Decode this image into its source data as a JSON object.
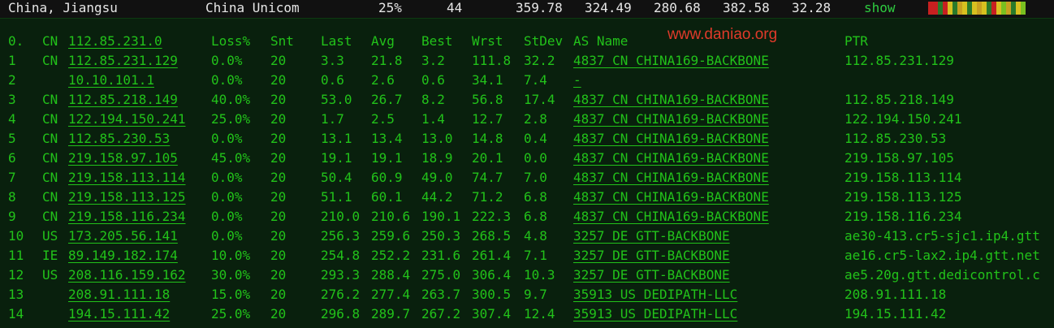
{
  "top": {
    "location": "China, Jiangsu",
    "isp": "China Unicom",
    "loss": "25%",
    "sent": "44",
    "last": "359.78",
    "avg": "324.49",
    "best": "280.68",
    "wrst": "382.58",
    "stdev": "32.28",
    "show": "show",
    "spark_colors": [
      "#c82020",
      "#c82020",
      "#2a7a2a",
      "#c82020",
      "#d8c020",
      "#2a7a2a",
      "#c8a020",
      "#d8c020",
      "#2a7a2a",
      "#d8c020",
      "#c8a020",
      "#d8c020",
      "#2a7a2a",
      "#c82020",
      "#d8c020",
      "#7ac020",
      "#c8a020",
      "#2a7a2a",
      "#d8c020",
      "#7ac020"
    ]
  },
  "watermark": "www.daniao.org",
  "header": {
    "idx": "0.",
    "cc": "CN",
    "host": "112.85.231.0",
    "loss": "Loss%",
    "snt": "Snt",
    "last": "Last",
    "avg": "Avg",
    "best": "Best",
    "wrst": "Wrst",
    "stdev": "StDev",
    "as": "AS Name",
    "ptr": "PTR"
  },
  "hops": [
    {
      "idx": "1",
      "cc": "CN",
      "host": "112.85.231.129",
      "loss": "0.0%",
      "snt": "20",
      "last": "3.3",
      "avg": "21.8",
      "best": "3.2",
      "wrst": "111.8",
      "stdev": "32.2",
      "as": "4837  CN CHINA169-BACKBONE",
      "ptr": "112.85.231.129"
    },
    {
      "idx": "2",
      "cc": "",
      "host": "10.10.101.1",
      "loss": "0.0%",
      "snt": "20",
      "last": "0.6",
      "avg": "2.6",
      "best": "0.6",
      "wrst": "34.1",
      "stdev": "7.4",
      "as": "-",
      "ptr": ""
    },
    {
      "idx": "3",
      "cc": "CN",
      "host": "112.85.218.149",
      "loss": "40.0%",
      "snt": "20",
      "last": "53.0",
      "avg": "26.7",
      "best": "8.2",
      "wrst": "56.8",
      "stdev": "17.4",
      "as": "4837  CN CHINA169-BACKBONE",
      "ptr": "112.85.218.149"
    },
    {
      "idx": "4",
      "cc": "CN",
      "host": "122.194.150.241",
      "loss": "25.0%",
      "snt": "20",
      "last": "1.7",
      "avg": "2.5",
      "best": "1.4",
      "wrst": "12.7",
      "stdev": "2.8",
      "as": "4837  CN CHINA169-BACKBONE",
      "ptr": "122.194.150.241"
    },
    {
      "idx": "5",
      "cc": "CN",
      "host": "112.85.230.53",
      "loss": "0.0%",
      "snt": "20",
      "last": "13.1",
      "avg": "13.4",
      "best": "13.0",
      "wrst": "14.8",
      "stdev": "0.4",
      "as": "4837  CN CHINA169-BACKBONE",
      "ptr": "112.85.230.53"
    },
    {
      "idx": "6",
      "cc": "CN",
      "host": "219.158.97.105",
      "loss": "45.0%",
      "snt": "20",
      "last": "19.1",
      "avg": "19.1",
      "best": "18.9",
      "wrst": "20.1",
      "stdev": "0.0",
      "as": "4837  CN CHINA169-BACKBONE",
      "ptr": "219.158.97.105"
    },
    {
      "idx": "7",
      "cc": "CN",
      "host": "219.158.113.114",
      "loss": "0.0%",
      "snt": "20",
      "last": "50.4",
      "avg": "60.9",
      "best": "49.0",
      "wrst": "74.7",
      "stdev": "7.0",
      "as": "4837  CN CHINA169-BACKBONE",
      "ptr": "219.158.113.114"
    },
    {
      "idx": "8",
      "cc": "CN",
      "host": "219.158.113.125",
      "loss": "0.0%",
      "snt": "20",
      "last": "51.1",
      "avg": "60.1",
      "best": "44.2",
      "wrst": "71.2",
      "stdev": "6.8",
      "as": "4837  CN CHINA169-BACKBONE",
      "ptr": "219.158.113.125"
    },
    {
      "idx": "9",
      "cc": "CN",
      "host": "219.158.116.234",
      "loss": "0.0%",
      "snt": "20",
      "last": "210.0",
      "avg": "210.6",
      "best": "190.1",
      "wrst": "222.3",
      "stdev": "6.8",
      "as": "4837  CN CHINA169-BACKBONE",
      "ptr": "219.158.116.234"
    },
    {
      "idx": "10",
      "cc": "US",
      "host": "173.205.56.141",
      "loss": "0.0%",
      "snt": "20",
      "last": "256.3",
      "avg": "259.6",
      "best": "250.3",
      "wrst": "268.5",
      "stdev": "4.8",
      "as": "3257  DE GTT-BACKBONE",
      "ptr": "ae30-413.cr5-sjc1.ip4.gtt"
    },
    {
      "idx": "11",
      "cc": "IE",
      "host": "89.149.182.174",
      "loss": "10.0%",
      "snt": "20",
      "last": "254.8",
      "avg": "252.2",
      "best": "231.6",
      "wrst": "261.4",
      "stdev": "7.1",
      "as": "3257  DE GTT-BACKBONE",
      "ptr": "ae16.cr5-lax2.ip4.gtt.net"
    },
    {
      "idx": "12",
      "cc": "US",
      "host": "208.116.159.162",
      "loss": "30.0%",
      "snt": "20",
      "last": "293.3",
      "avg": "288.4",
      "best": "275.0",
      "wrst": "306.4",
      "stdev": "10.3",
      "as": "3257  DE GTT-BACKBONE",
      "ptr": "ae5.20g.gtt.dedicontrol.c"
    },
    {
      "idx": "13",
      "cc": "",
      "host": "208.91.111.18",
      "loss": "15.0%",
      "snt": "20",
      "last": "276.2",
      "avg": "277.4",
      "best": "263.7",
      "wrst": "300.5",
      "stdev": "9.7",
      "as": "35913 US DEDIPATH-LLC",
      "ptr": "208.91.111.18"
    },
    {
      "idx": "14",
      "cc": "",
      "host": "194.15.111.42",
      "loss": "25.0%",
      "snt": "20",
      "last": "296.8",
      "avg": "289.7",
      "best": "267.2",
      "wrst": "307.4",
      "stdev": "12.4",
      "as": "35913 US DEDIPATH-LLC",
      "ptr": "194.15.111.42"
    }
  ]
}
